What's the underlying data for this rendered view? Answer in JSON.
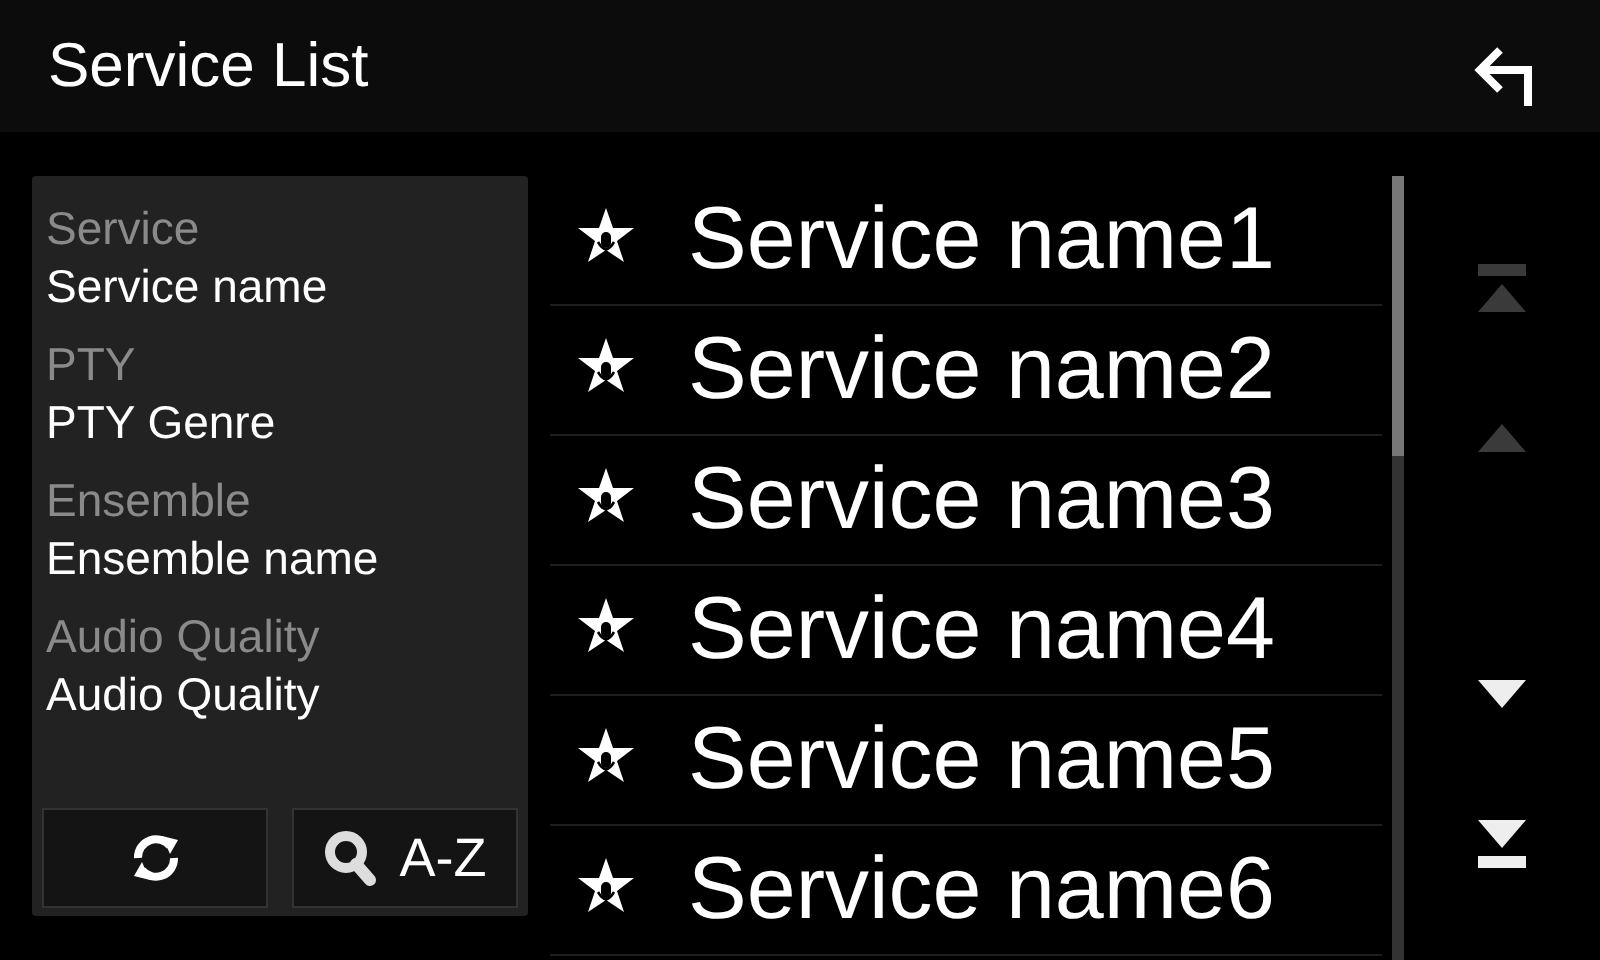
{
  "header": {
    "title": "Service List"
  },
  "info": [
    {
      "label": "Service",
      "value": "Service name"
    },
    {
      "label": "PTY",
      "value": "PTY Genre"
    },
    {
      "label": "Ensemble",
      "value": "Ensemble name"
    },
    {
      "label": "Audio Quality",
      "value": "Audio Quality"
    }
  ],
  "search_button": {
    "label": "A-Z"
  },
  "services": [
    {
      "name": "Service name1"
    },
    {
      "name": "Service name2"
    },
    {
      "name": "Service name3"
    },
    {
      "name": "Service name4"
    },
    {
      "name": "Service name5"
    },
    {
      "name": "Service name6"
    }
  ],
  "scroll_buttons": [
    {
      "kind": "top",
      "disabled": true
    },
    {
      "kind": "up",
      "disabled": true
    },
    {
      "kind": "down",
      "disabled": false
    },
    {
      "kind": "bottom",
      "disabled": false
    }
  ]
}
